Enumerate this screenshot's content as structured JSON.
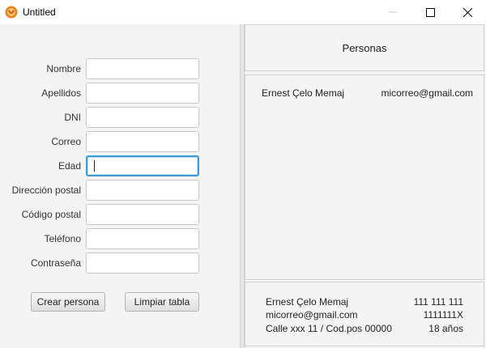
{
  "window": {
    "title": "Untitled"
  },
  "form": {
    "fields": [
      {
        "label": "Nombre",
        "value": ""
      },
      {
        "label": "Apellidos",
        "value": ""
      },
      {
        "label": "DNI",
        "value": ""
      },
      {
        "label": "Correo",
        "value": ""
      },
      {
        "label": "Edad",
        "value": ""
      },
      {
        "label": "Dirección postal",
        "value": ""
      },
      {
        "label": "Código postal",
        "value": ""
      },
      {
        "label": "Teléfono",
        "value": ""
      },
      {
        "label": "Contraseña",
        "value": ""
      }
    ],
    "create_button": "Crear persona",
    "clear_button": "Limpiar tabla"
  },
  "people_panel": {
    "title": "Personas",
    "list": [
      {
        "name": "Ernest Çelo Memaj",
        "email": "micorreo@gmail.com"
      }
    ]
  },
  "detail": {
    "name": "Ernest Çelo Memaj",
    "phone": "111 111 111",
    "email": "micorreo@gmail.com",
    "dni": "1111111X",
    "address": "Calle xxx 11 / Cod.pos 00000",
    "age": "18 años"
  },
  "colors": {
    "focus_border": "#3c9ad6",
    "close_hover": "#e81123"
  }
}
